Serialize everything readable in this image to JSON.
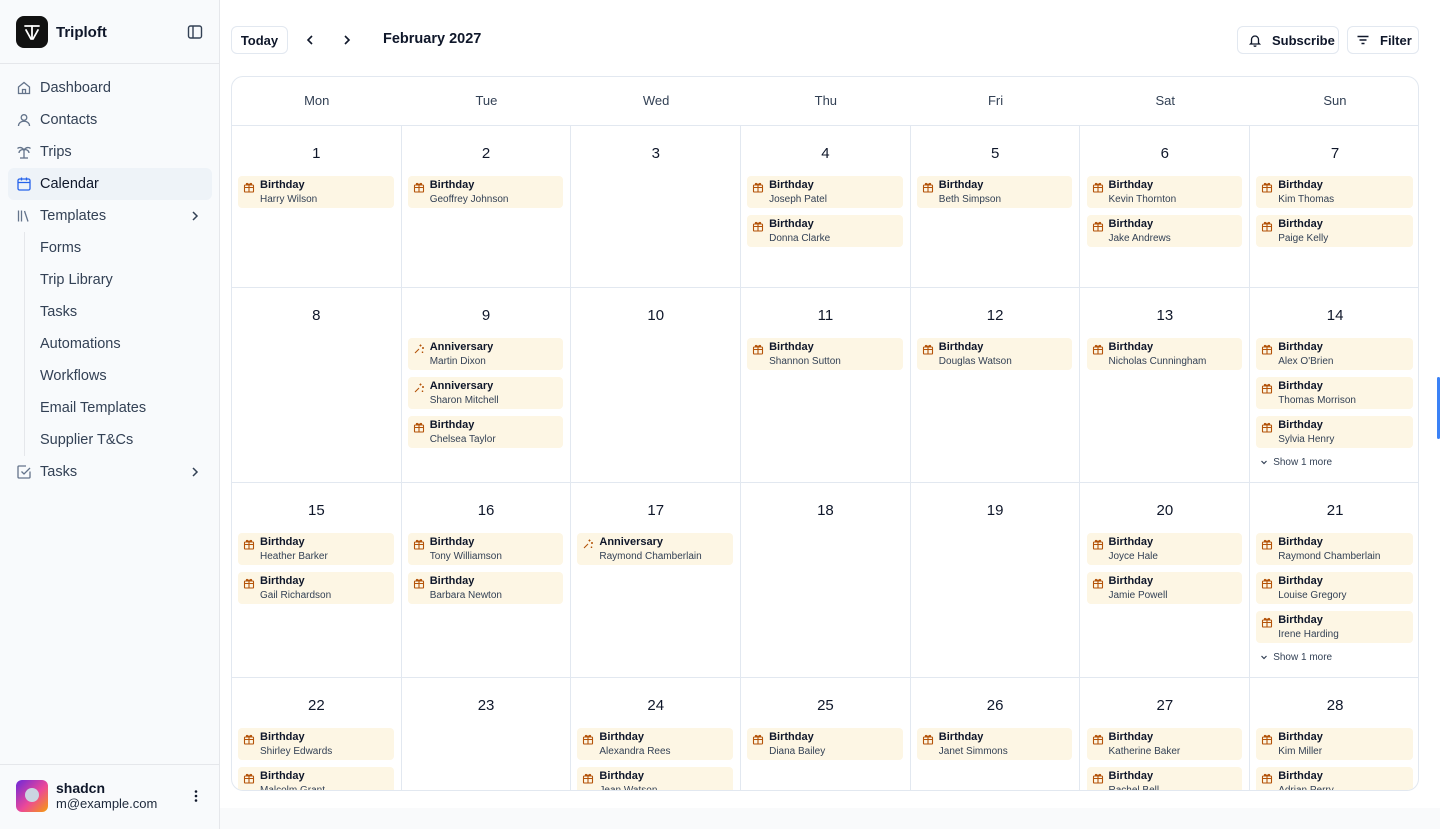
{
  "app": {
    "name": "Triploft"
  },
  "sidebar": {
    "items": [
      {
        "label": "Dashboard",
        "icon": "home-icon"
      },
      {
        "label": "Contacts",
        "icon": "user-icon"
      },
      {
        "label": "Trips",
        "icon": "palm-tree-icon"
      },
      {
        "label": "Calendar",
        "icon": "calendar-icon",
        "active": true
      },
      {
        "label": "Templates",
        "icon": "library-icon",
        "expandable": true
      }
    ],
    "templates_children": [
      "Forms",
      "Trip Library",
      "Tasks",
      "Automations",
      "Workflows",
      "Email Templates",
      "Supplier T&Cs"
    ],
    "tasks_item": {
      "label": "Tasks",
      "icon": "check-square-icon"
    }
  },
  "user": {
    "name": "shadcn",
    "email": "m@example.com"
  },
  "toolbar": {
    "today_label": "Today",
    "month_title": "February 2027",
    "subscribe_label": "Subscribe",
    "filter_label": "Filter"
  },
  "calendar": {
    "weekdays": [
      "Mon",
      "Tue",
      "Wed",
      "Thu",
      "Fri",
      "Sat",
      "Sun"
    ],
    "weeks": [
      [
        {
          "day": "1",
          "events": [
            {
              "title": "Birthday",
              "name": "Harry Wilson"
            }
          ]
        },
        {
          "day": "2",
          "events": [
            {
              "title": "Birthday",
              "name": "Geoffrey Johnson"
            }
          ]
        },
        {
          "day": "3",
          "events": []
        },
        {
          "day": "4",
          "events": [
            {
              "title": "Birthday",
              "name": "Joseph Patel"
            },
            {
              "title": "Birthday",
              "name": "Donna Clarke"
            }
          ]
        },
        {
          "day": "5",
          "events": [
            {
              "title": "Birthday",
              "name": "Beth Simpson"
            }
          ]
        },
        {
          "day": "6",
          "events": [
            {
              "title": "Birthday",
              "name": "Kevin Thornton"
            },
            {
              "title": "Birthday",
              "name": "Jake Andrews"
            }
          ]
        },
        {
          "day": "7",
          "events": [
            {
              "title": "Birthday",
              "name": "Kim Thomas"
            },
            {
              "title": "Birthday",
              "name": "Paige Kelly"
            }
          ]
        }
      ],
      [
        {
          "day": "8",
          "events": []
        },
        {
          "day": "9",
          "events": [
            {
              "title": "Anniversary",
              "name": "Martin Dixon"
            },
            {
              "title": "Anniversary",
              "name": "Sharon Mitchell"
            },
            {
              "title": "Birthday",
              "name": "Chelsea Taylor"
            }
          ]
        },
        {
          "day": "10",
          "events": []
        },
        {
          "day": "11",
          "events": [
            {
              "title": "Birthday",
              "name": "Shannon Sutton"
            }
          ]
        },
        {
          "day": "12",
          "events": [
            {
              "title": "Birthday",
              "name": "Douglas Watson"
            }
          ]
        },
        {
          "day": "13",
          "events": [
            {
              "title": "Birthday",
              "name": "Nicholas Cunningham"
            }
          ]
        },
        {
          "day": "14",
          "events": [
            {
              "title": "Birthday",
              "name": "Alex O'Brien"
            },
            {
              "title": "Birthday",
              "name": "Thomas Morrison"
            },
            {
              "title": "Birthday",
              "name": "Sylvia Henry"
            }
          ],
          "more": "Show 1 more"
        }
      ],
      [
        {
          "day": "15",
          "events": [
            {
              "title": "Birthday",
              "name": "Heather Barker"
            },
            {
              "title": "Birthday",
              "name": "Gail Richardson"
            }
          ]
        },
        {
          "day": "16",
          "events": [
            {
              "title": "Birthday",
              "name": "Tony Williamson"
            },
            {
              "title": "Birthday",
              "name": "Barbara Newton"
            }
          ]
        },
        {
          "day": "17",
          "events": [
            {
              "title": "Anniversary",
              "name": "Raymond Chamberlain"
            }
          ]
        },
        {
          "day": "18",
          "events": []
        },
        {
          "day": "19",
          "events": []
        },
        {
          "day": "20",
          "events": [
            {
              "title": "Birthday",
              "name": "Joyce Hale"
            },
            {
              "title": "Birthday",
              "name": "Jamie Powell"
            }
          ]
        },
        {
          "day": "21",
          "events": [
            {
              "title": "Birthday",
              "name": "Raymond Chamberlain"
            },
            {
              "title": "Birthday",
              "name": "Louise Gregory"
            },
            {
              "title": "Birthday",
              "name": "Irene Harding"
            }
          ],
          "more": "Show 1 more"
        }
      ],
      [
        {
          "day": "22",
          "events": [
            {
              "title": "Birthday",
              "name": "Shirley Edwards"
            },
            {
              "title": "Birthday",
              "name": "Malcolm Grant"
            }
          ]
        },
        {
          "day": "23",
          "events": []
        },
        {
          "day": "24",
          "events": [
            {
              "title": "Birthday",
              "name": "Alexandra Rees"
            },
            {
              "title": "Birthday",
              "name": "Jean Watson"
            }
          ]
        },
        {
          "day": "25",
          "events": [
            {
              "title": "Birthday",
              "name": "Diana Bailey"
            }
          ]
        },
        {
          "day": "26",
          "events": [
            {
              "title": "Birthday",
              "name": "Janet Simmons"
            }
          ]
        },
        {
          "day": "27",
          "events": [
            {
              "title": "Birthday",
              "name": "Katherine Baker"
            },
            {
              "title": "Birthday",
              "name": "Rachel Bell"
            }
          ]
        },
        {
          "day": "28",
          "events": [
            {
              "title": "Birthday",
              "name": "Kim Miller"
            },
            {
              "title": "Birthday",
              "name": "Adrian Perry"
            }
          ]
        }
      ]
    ]
  },
  "colors": {
    "event_bg": "#fdf6e4",
    "event_icon": "#b45309",
    "active_nav": "#2563eb",
    "border": "#e2e8f0"
  }
}
